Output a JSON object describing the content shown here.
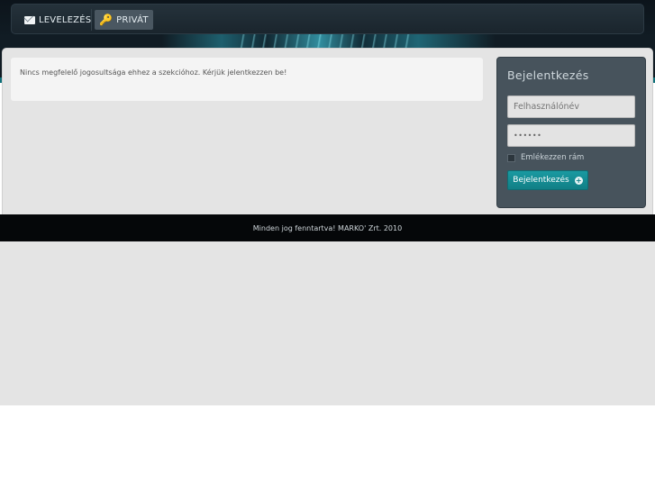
{
  "nav": {
    "items": [
      {
        "label": "LEVELEZÉS",
        "icon": "mail-icon"
      },
      {
        "label": "PRIVÁT",
        "icon": "key-icon"
      }
    ]
  },
  "main": {
    "notice": "Nincs megfelelő jogosultsága ehhez a szekcióhoz. Kérjük jelentkezzen be!"
  },
  "login": {
    "title": "Bejelentkezés",
    "username_placeholder": "Felhasználónév",
    "password_value": "••••••",
    "remember_label": "Emlékezzen rám",
    "button_label": "Bejelentkezés"
  },
  "footer": {
    "text": "Minden jog fenntartva! MARKO' Zrt. 2010"
  },
  "colors": {
    "accent": "#118c95",
    "header_bg": "#111c24",
    "panel_bg": "#e4e4e4",
    "login_bg": "#47535c"
  }
}
